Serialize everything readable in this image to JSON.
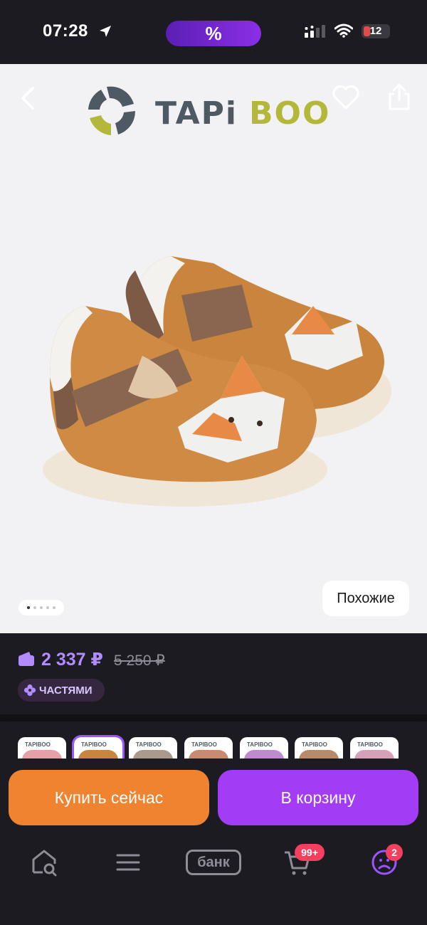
{
  "status_bar": {
    "time": "07:28",
    "promo": "%",
    "battery": "12",
    "battery_color": "#e34b4b"
  },
  "header": {
    "back_icon": "chevron-left-icon",
    "favorite_icon": "heart-icon",
    "share_icon": "share-icon"
  },
  "brand": {
    "name": "TAPIBOO",
    "colors": {
      "dark": "#4e5a63",
      "accent": "#b4b83a"
    }
  },
  "gallery": {
    "pages": 5,
    "current_page": 1,
    "similar_label": "Похожие"
  },
  "price": {
    "current": "2 337 ₽",
    "old": "5 250 ₽",
    "installments_label": "ЧАСТЯМИ",
    "accent": "#b18cff"
  },
  "variants": [
    {
      "logo": "TAPIBOO",
      "color": "#e8a0a8",
      "selected": false
    },
    {
      "logo": "TAPIBOO",
      "color": "#c9853e",
      "selected": true
    },
    {
      "logo": "TAPIBOO",
      "color": "#a99a8c",
      "selected": false
    },
    {
      "logo": "TAPIBOO",
      "color": "#c98a70",
      "selected": false
    },
    {
      "logo": "TAPIBOO",
      "color": "#c08ad0",
      "selected": false
    },
    {
      "logo": "TAPIBOO",
      "color": "#b98a68",
      "selected": false
    },
    {
      "logo": "TAPIBOO",
      "color": "#d8a0b8",
      "selected": false
    }
  ],
  "actions": {
    "buy_now": "Купить сейчас",
    "add_to_cart": "В корзину",
    "buy_color": "#f0832f",
    "cart_color": "#a23cf5"
  },
  "bottom_nav": {
    "home_icon": "home-search-icon",
    "catalog_icon": "menu-icon",
    "bank_label": "банк",
    "cart_icon": "cart-icon",
    "cart_count": "99+",
    "profile_icon": "profile-icon",
    "profile_count": "2"
  }
}
